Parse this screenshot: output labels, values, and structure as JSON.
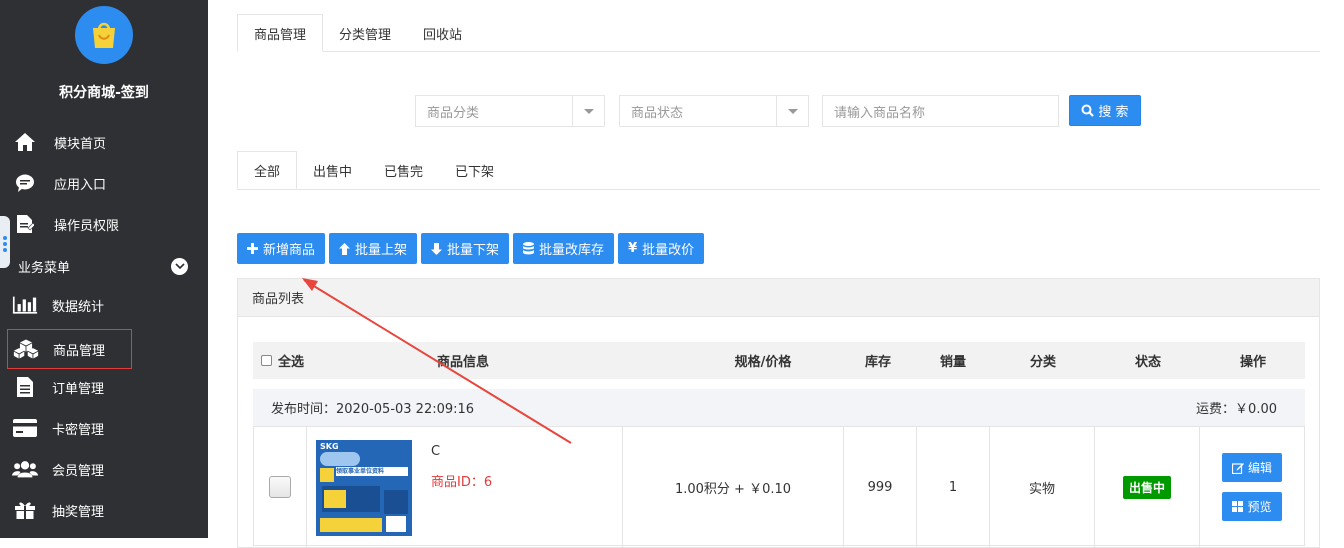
{
  "app": {
    "title": "积分商城-签到",
    "brand_color": "#2d8cf0"
  },
  "sidebar": {
    "items": [
      {
        "label": "模块首页",
        "icon": "home-icon"
      },
      {
        "label": "应用入口",
        "icon": "chat-bubble-icon"
      },
      {
        "label": "操作员权限",
        "icon": "document-edit-icon"
      }
    ],
    "section": {
      "label": "业务菜单",
      "icon": "chevron-down-icon"
    },
    "sub_items": [
      {
        "label": "数据统计",
        "icon": "bar-chart-icon"
      },
      {
        "label": "商品管理",
        "icon": "cubes-icon",
        "active": true
      },
      {
        "label": "订单管理",
        "icon": "file-text-icon"
      },
      {
        "label": "卡密管理",
        "icon": "credit-card-icon"
      },
      {
        "label": "会员管理",
        "icon": "users-icon"
      },
      {
        "label": "抽奖管理",
        "icon": "gift-icon"
      }
    ]
  },
  "top_tabs": [
    {
      "label": "商品管理",
      "active": true
    },
    {
      "label": "分类管理",
      "active": false
    },
    {
      "label": "回收站",
      "active": false
    }
  ],
  "filters": {
    "category_placeholder": "商品分类",
    "status_placeholder": "商品状态",
    "name_placeholder": "请输入商品名称",
    "search_label": "搜 索"
  },
  "status_tabs": [
    {
      "label": "全部",
      "active": true
    },
    {
      "label": "出售中",
      "active": false
    },
    {
      "label": "已售完",
      "active": false
    },
    {
      "label": "已下架",
      "active": false
    }
  ],
  "actions": {
    "add": "新增商品",
    "batch_on": "批量上架",
    "batch_off": "批量下架",
    "batch_stock": "批量改库存",
    "batch_price": "批量改价"
  },
  "list": {
    "title": "商品列表",
    "columns": {
      "select_all": "全选",
      "info": "商品信息",
      "spec_price": "规格/价格",
      "stock": "库存",
      "sales": "销量",
      "category": "分类",
      "status": "状态",
      "ops": "操作"
    },
    "group": {
      "publish_time": "发布时间：2020-05-03 22:09:16",
      "shipping": "运费：￥0.00"
    },
    "row": {
      "name": "C",
      "product_id": "商品ID：6",
      "price": "1.00积分 + ￥0.10",
      "stock": "999",
      "sales": "1",
      "category": "实物",
      "status": "出售中",
      "edit": "编辑",
      "preview": "预览"
    },
    "thumb": {
      "brand": "SKG",
      "headline": "领取事业单位资料"
    }
  },
  "annotation_color": "#e8453c",
  "status_color": "#009900"
}
